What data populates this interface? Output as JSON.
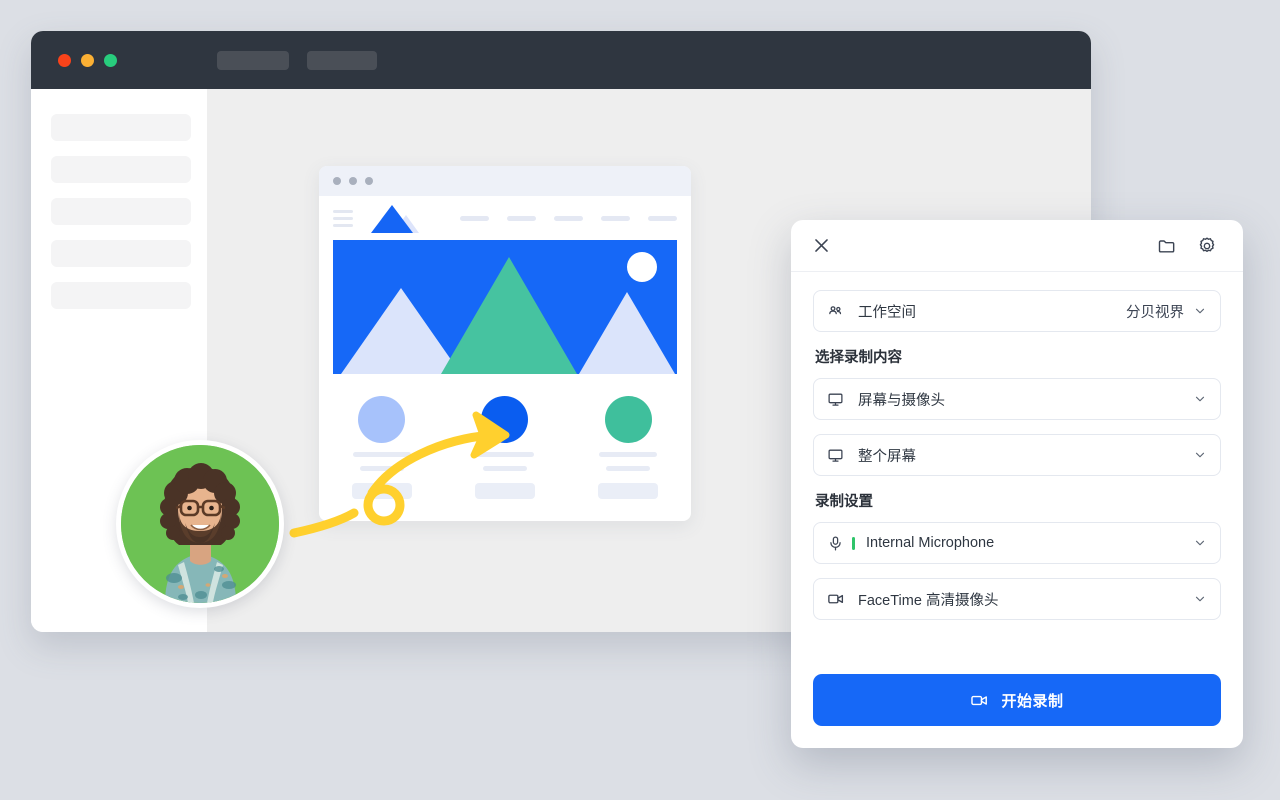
{
  "background_color": "#dcdfe5",
  "app_window": {
    "titlebar": {
      "traffic_lights": [
        "red",
        "yellow",
        "green"
      ],
      "colors": {
        "red": "#f9431a",
        "yellow": "#fbb034",
        "green": "#28cd7d",
        "bar": "#2f3640"
      },
      "tab_placeholders": 2
    },
    "sidebar": {
      "placeholder_items": 5
    },
    "content": {
      "browser_mockup": {
        "titlebar_dots": 3,
        "nav": {
          "menu_icon": "hamburger-icon",
          "logo": "triangle-logo",
          "link_placeholders": 5
        },
        "hero": {
          "background_color": "#1668f7",
          "sun_color": "#ffffff",
          "mountain_colors": [
            "#dbe4fb",
            "#46c3a0",
            "#dbe4fb"
          ]
        },
        "cards": [
          {
            "circle_color": "#a7c2fb"
          },
          {
            "circle_color": "#0a5df0"
          },
          {
            "circle_color": "#3fbf9c"
          }
        ]
      },
      "annotation": {
        "type": "hand-drawn-arrow",
        "color": "#ffd02e",
        "points_at": "middle-card-circle"
      }
    }
  },
  "webcam_bubble": {
    "background_color": "#6dc254",
    "ring_color": "#ffffff",
    "subject": "person with curly hair, glasses, beard and patterned shirt"
  },
  "recorder_panel": {
    "header": {
      "close_icon": "close-icon",
      "folder_icon": "folder-icon",
      "settings_icon": "gear-icon"
    },
    "workspace": {
      "icon": "users-icon",
      "label": "工作空间",
      "value": "分贝视界",
      "chevron": "chevron-down-icon"
    },
    "capture_section": {
      "title": "选择录制内容",
      "options": [
        {
          "icon": "monitor-icon",
          "label": "屏幕与摄像头",
          "chevron": "chevron-down-icon"
        },
        {
          "icon": "monitor-icon",
          "label": "整个屏幕",
          "chevron": "chevron-down-icon"
        }
      ]
    },
    "settings_section": {
      "title": "录制设置",
      "options": [
        {
          "icon": "microphone-icon",
          "label": "Internal Microphone",
          "chevron": "chevron-down-icon",
          "level_color": "#2fc46a"
        },
        {
          "icon": "video-camera-icon",
          "label": "FaceTime 高清摄像头",
          "chevron": "chevron-down-icon"
        }
      ]
    },
    "start_button": {
      "icon": "video-camera-icon",
      "label": "开始录制",
      "color": "#1668f7"
    }
  }
}
